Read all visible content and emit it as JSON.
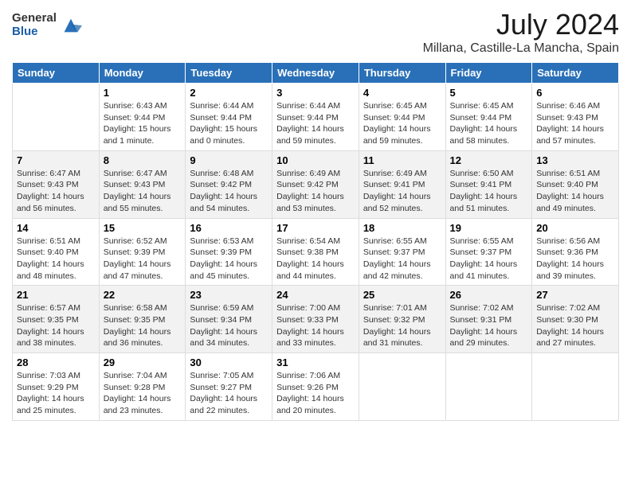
{
  "header": {
    "logo_general": "General",
    "logo_blue": "Blue",
    "title": "July 2024",
    "subtitle": "Millana, Castille-La Mancha, Spain"
  },
  "days_of_week": [
    "Sunday",
    "Monday",
    "Tuesday",
    "Wednesday",
    "Thursday",
    "Friday",
    "Saturday"
  ],
  "weeks": [
    [
      {
        "day": "",
        "sunrise": "",
        "sunset": "",
        "daylight": ""
      },
      {
        "day": "1",
        "sunrise": "Sunrise: 6:43 AM",
        "sunset": "Sunset: 9:44 PM",
        "daylight": "Daylight: 15 hours and 1 minute."
      },
      {
        "day": "2",
        "sunrise": "Sunrise: 6:44 AM",
        "sunset": "Sunset: 9:44 PM",
        "daylight": "Daylight: 15 hours and 0 minutes."
      },
      {
        "day": "3",
        "sunrise": "Sunrise: 6:44 AM",
        "sunset": "Sunset: 9:44 PM",
        "daylight": "Daylight: 14 hours and 59 minutes."
      },
      {
        "day": "4",
        "sunrise": "Sunrise: 6:45 AM",
        "sunset": "Sunset: 9:44 PM",
        "daylight": "Daylight: 14 hours and 59 minutes."
      },
      {
        "day": "5",
        "sunrise": "Sunrise: 6:45 AM",
        "sunset": "Sunset: 9:44 PM",
        "daylight": "Daylight: 14 hours and 58 minutes."
      },
      {
        "day": "6",
        "sunrise": "Sunrise: 6:46 AM",
        "sunset": "Sunset: 9:43 PM",
        "daylight": "Daylight: 14 hours and 57 minutes."
      }
    ],
    [
      {
        "day": "7",
        "sunrise": "Sunrise: 6:47 AM",
        "sunset": "Sunset: 9:43 PM",
        "daylight": "Daylight: 14 hours and 56 minutes."
      },
      {
        "day": "8",
        "sunrise": "Sunrise: 6:47 AM",
        "sunset": "Sunset: 9:43 PM",
        "daylight": "Daylight: 14 hours and 55 minutes."
      },
      {
        "day": "9",
        "sunrise": "Sunrise: 6:48 AM",
        "sunset": "Sunset: 9:42 PM",
        "daylight": "Daylight: 14 hours and 54 minutes."
      },
      {
        "day": "10",
        "sunrise": "Sunrise: 6:49 AM",
        "sunset": "Sunset: 9:42 PM",
        "daylight": "Daylight: 14 hours and 53 minutes."
      },
      {
        "day": "11",
        "sunrise": "Sunrise: 6:49 AM",
        "sunset": "Sunset: 9:41 PM",
        "daylight": "Daylight: 14 hours and 52 minutes."
      },
      {
        "day": "12",
        "sunrise": "Sunrise: 6:50 AM",
        "sunset": "Sunset: 9:41 PM",
        "daylight": "Daylight: 14 hours and 51 minutes."
      },
      {
        "day": "13",
        "sunrise": "Sunrise: 6:51 AM",
        "sunset": "Sunset: 9:40 PM",
        "daylight": "Daylight: 14 hours and 49 minutes."
      }
    ],
    [
      {
        "day": "14",
        "sunrise": "Sunrise: 6:51 AM",
        "sunset": "Sunset: 9:40 PM",
        "daylight": "Daylight: 14 hours and 48 minutes."
      },
      {
        "day": "15",
        "sunrise": "Sunrise: 6:52 AM",
        "sunset": "Sunset: 9:39 PM",
        "daylight": "Daylight: 14 hours and 47 minutes."
      },
      {
        "day": "16",
        "sunrise": "Sunrise: 6:53 AM",
        "sunset": "Sunset: 9:39 PM",
        "daylight": "Daylight: 14 hours and 45 minutes."
      },
      {
        "day": "17",
        "sunrise": "Sunrise: 6:54 AM",
        "sunset": "Sunset: 9:38 PM",
        "daylight": "Daylight: 14 hours and 44 minutes."
      },
      {
        "day": "18",
        "sunrise": "Sunrise: 6:55 AM",
        "sunset": "Sunset: 9:37 PM",
        "daylight": "Daylight: 14 hours and 42 minutes."
      },
      {
        "day": "19",
        "sunrise": "Sunrise: 6:55 AM",
        "sunset": "Sunset: 9:37 PM",
        "daylight": "Daylight: 14 hours and 41 minutes."
      },
      {
        "day": "20",
        "sunrise": "Sunrise: 6:56 AM",
        "sunset": "Sunset: 9:36 PM",
        "daylight": "Daylight: 14 hours and 39 minutes."
      }
    ],
    [
      {
        "day": "21",
        "sunrise": "Sunrise: 6:57 AM",
        "sunset": "Sunset: 9:35 PM",
        "daylight": "Daylight: 14 hours and 38 minutes."
      },
      {
        "day": "22",
        "sunrise": "Sunrise: 6:58 AM",
        "sunset": "Sunset: 9:35 PM",
        "daylight": "Daylight: 14 hours and 36 minutes."
      },
      {
        "day": "23",
        "sunrise": "Sunrise: 6:59 AM",
        "sunset": "Sunset: 9:34 PM",
        "daylight": "Daylight: 14 hours and 34 minutes."
      },
      {
        "day": "24",
        "sunrise": "Sunrise: 7:00 AM",
        "sunset": "Sunset: 9:33 PM",
        "daylight": "Daylight: 14 hours and 33 minutes."
      },
      {
        "day": "25",
        "sunrise": "Sunrise: 7:01 AM",
        "sunset": "Sunset: 9:32 PM",
        "daylight": "Daylight: 14 hours and 31 minutes."
      },
      {
        "day": "26",
        "sunrise": "Sunrise: 7:02 AM",
        "sunset": "Sunset: 9:31 PM",
        "daylight": "Daylight: 14 hours and 29 minutes."
      },
      {
        "day": "27",
        "sunrise": "Sunrise: 7:02 AM",
        "sunset": "Sunset: 9:30 PM",
        "daylight": "Daylight: 14 hours and 27 minutes."
      }
    ],
    [
      {
        "day": "28",
        "sunrise": "Sunrise: 7:03 AM",
        "sunset": "Sunset: 9:29 PM",
        "daylight": "Daylight: 14 hours and 25 minutes."
      },
      {
        "day": "29",
        "sunrise": "Sunrise: 7:04 AM",
        "sunset": "Sunset: 9:28 PM",
        "daylight": "Daylight: 14 hours and 23 minutes."
      },
      {
        "day": "30",
        "sunrise": "Sunrise: 7:05 AM",
        "sunset": "Sunset: 9:27 PM",
        "daylight": "Daylight: 14 hours and 22 minutes."
      },
      {
        "day": "31",
        "sunrise": "Sunrise: 7:06 AM",
        "sunset": "Sunset: 9:26 PM",
        "daylight": "Daylight: 14 hours and 20 minutes."
      },
      {
        "day": "",
        "sunrise": "",
        "sunset": "",
        "daylight": ""
      },
      {
        "day": "",
        "sunrise": "",
        "sunset": "",
        "daylight": ""
      },
      {
        "day": "",
        "sunrise": "",
        "sunset": "",
        "daylight": ""
      }
    ]
  ]
}
